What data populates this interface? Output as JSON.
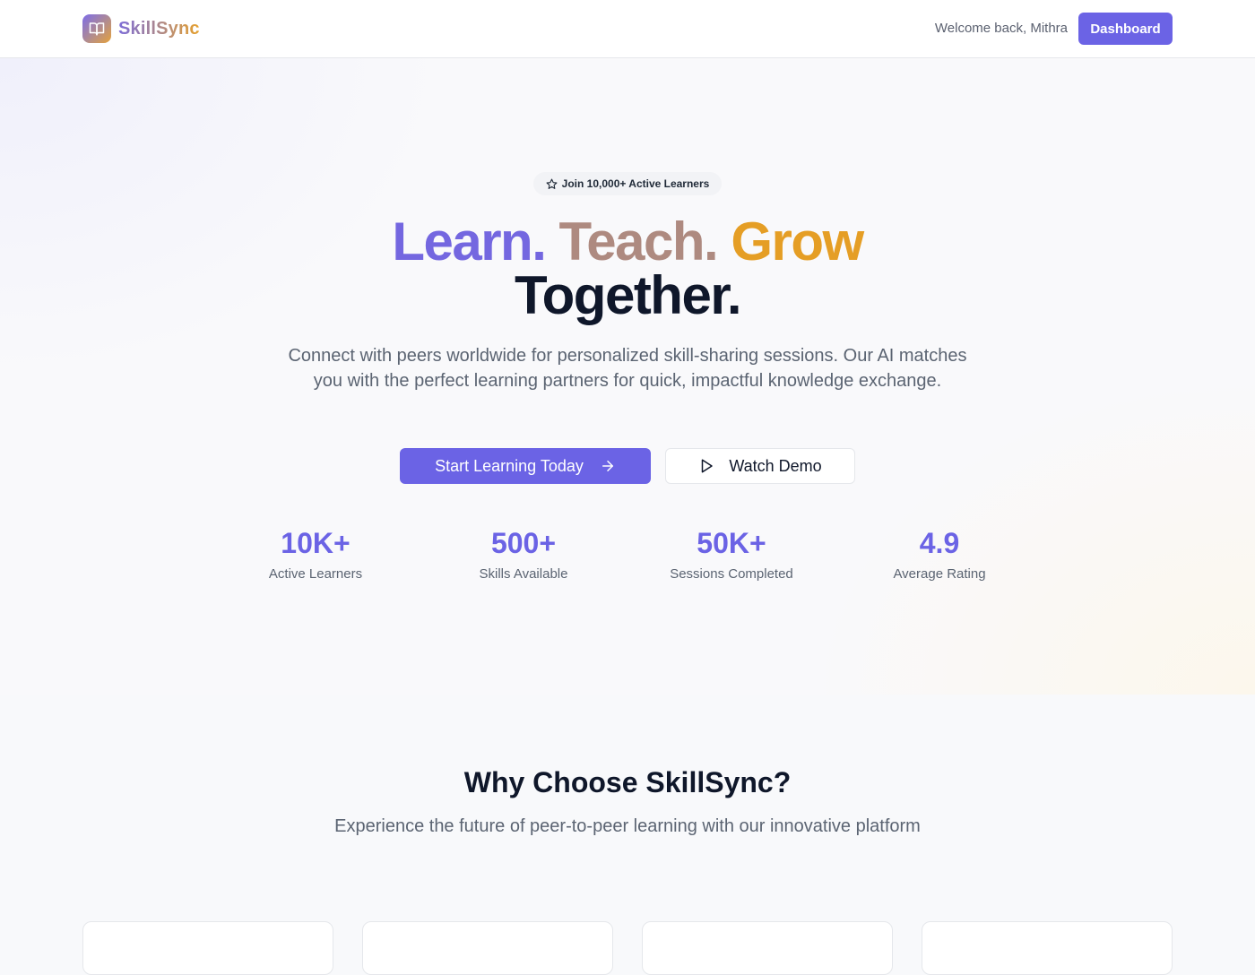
{
  "header": {
    "brand": "SkillSync",
    "welcome": "Welcome back, Mithra",
    "dashboard_label": "Dashboard"
  },
  "hero": {
    "badge": "Join 10,000+ Active Learners",
    "headline": {
      "learn": "Learn.",
      "teach": "Teach.",
      "grow": "Grow",
      "together": "Together."
    },
    "subtitle": "Connect with peers worldwide for personalized skill-sharing sessions. Our AI matches you with the perfect learning partners for quick, impactful knowledge exchange.",
    "primary_cta": "Start Learning Today",
    "secondary_cta": "Watch Demo",
    "stats": [
      {
        "value": "10K+",
        "label": "Active Learners"
      },
      {
        "value": "500+",
        "label": "Skills Available"
      },
      {
        "value": "50K+",
        "label": "Sessions Completed"
      },
      {
        "value": "4.9",
        "label": "Average Rating"
      }
    ]
  },
  "features": {
    "title": "Why Choose SkillSync?",
    "subtitle": "Experience the future of peer-to-peer learning with our innovative platform"
  },
  "colors": {
    "primary": "#6b63e5",
    "brand_gradient_start": "#7d6dd8",
    "brand_gradient_end": "#e7a12c"
  },
  "icons": {
    "brand": "book-open-icon",
    "badge": "star-icon",
    "primary_cta": "arrow-right-icon",
    "secondary_cta": "play-icon"
  }
}
